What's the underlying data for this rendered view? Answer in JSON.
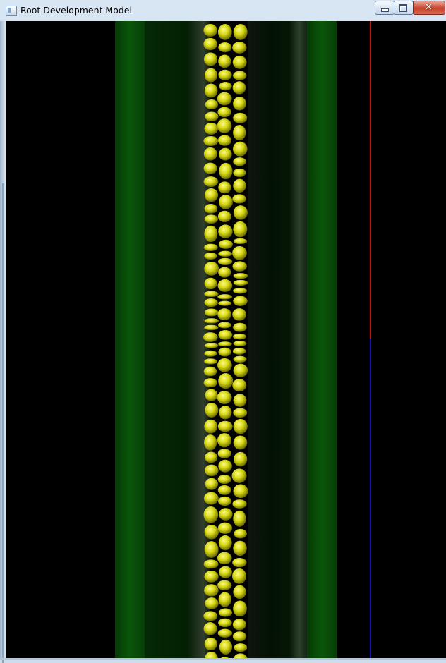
{
  "window": {
    "title": "Root Development Model",
    "ghost_title": "Root Development Model",
    "controls": {
      "minimize": "minimize",
      "maximize": "maximize",
      "close": "close"
    }
  },
  "viewport": {
    "background": "#000000",
    "tissue_color": "#0a560a",
    "cell_color": "#d8d814",
    "marker_top_color": "#c01010",
    "marker_bottom_color": "#1010b8"
  }
}
